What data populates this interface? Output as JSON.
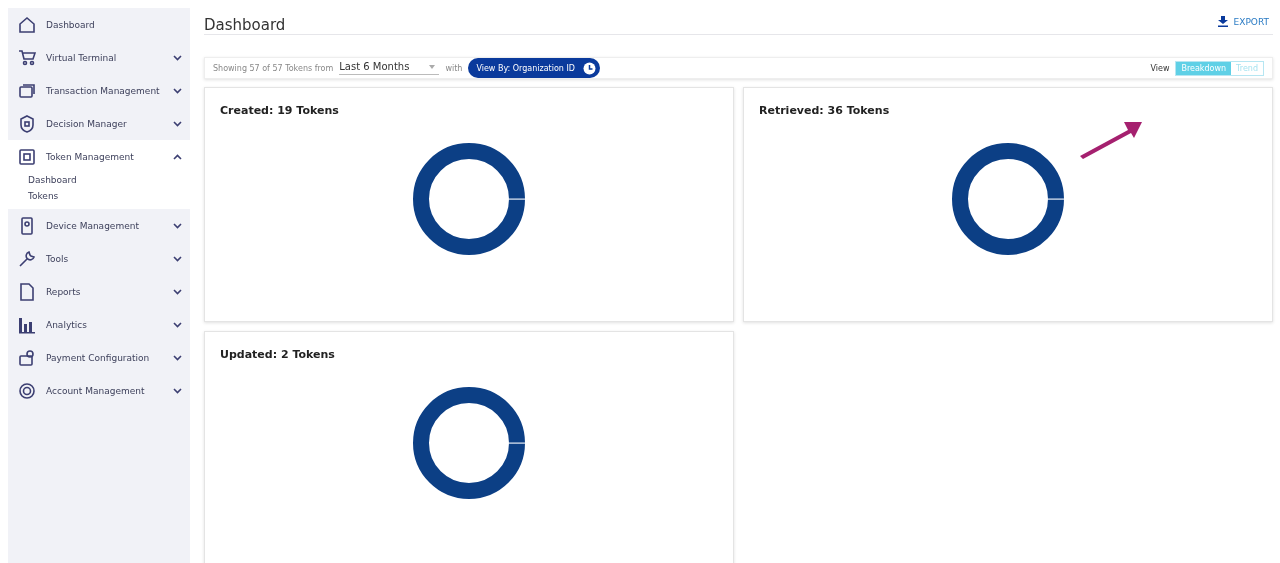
{
  "sidebar": {
    "items": [
      {
        "label": "Dashboard",
        "kind": "link"
      },
      {
        "label": "Virtual Terminal",
        "kind": "group",
        "expanded": false
      },
      {
        "label": "Transaction Management",
        "kind": "group",
        "expanded": false
      },
      {
        "label": "Decision Manager",
        "kind": "group",
        "expanded": false
      },
      {
        "label": "Token Management",
        "kind": "group",
        "expanded": true,
        "children": [
          {
            "label": "Dashboard"
          },
          {
            "label": "Tokens"
          }
        ]
      },
      {
        "label": "Device Management",
        "kind": "group",
        "expanded": false
      },
      {
        "label": "Tools",
        "kind": "group",
        "expanded": false
      },
      {
        "label": "Reports",
        "kind": "group",
        "expanded": false
      },
      {
        "label": "Analytics",
        "kind": "group",
        "expanded": false
      },
      {
        "label": "Payment Configuration",
        "kind": "group",
        "expanded": false
      },
      {
        "label": "Account Management",
        "kind": "group",
        "expanded": false
      }
    ]
  },
  "header": {
    "title": "Dashboard",
    "export": "EXPORT"
  },
  "filter_bar": {
    "showing": "Showing 57 of 57 Tokens from",
    "range": "Last 6 Months",
    "with": "with",
    "view_by": "View By: Organization ID",
    "view_label": "View",
    "view_options": [
      {
        "label": "Breakdown",
        "selected": true
      },
      {
        "label": "Trend",
        "selected": false
      }
    ]
  },
  "cards": [
    {
      "title": "Created: 19 Tokens"
    },
    {
      "title": "Retrieved: 36 Tokens"
    },
    {
      "title": "Updated: 2 Tokens"
    }
  ]
}
